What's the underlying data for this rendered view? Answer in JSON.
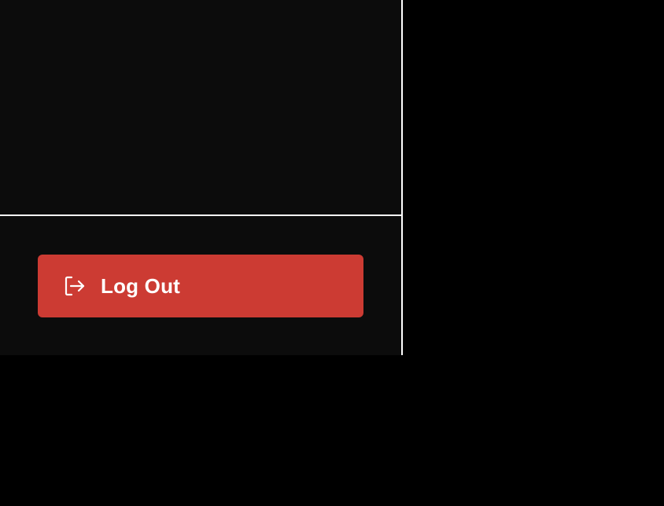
{
  "sidebar": {
    "footer": {
      "logout_button": {
        "label": "Log Out",
        "icon": "logout-icon"
      }
    }
  },
  "colors": {
    "background": "#000000",
    "panel": "#0c0c0c",
    "divider": "#ffffff",
    "danger_accent": "#cc3b33",
    "button_text": "#ffffff"
  }
}
